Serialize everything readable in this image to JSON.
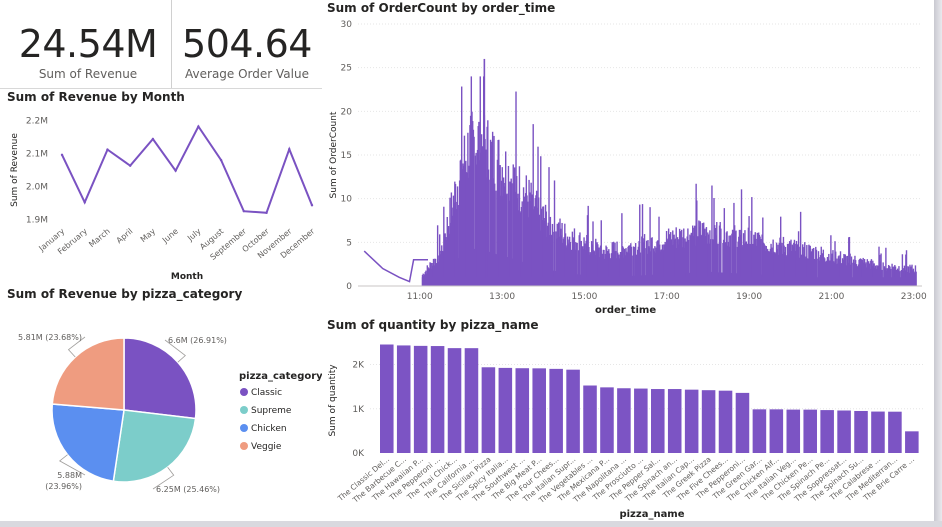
{
  "cards": [
    {
      "value": "24.54M",
      "label": "Sum of Revenue"
    },
    {
      "value": "504.64",
      "label": "Average Order Value"
    }
  ],
  "colors": {
    "accent": "#7a52c2",
    "bar": "#7c54c4"
  },
  "chart_data": [
    {
      "type": "line",
      "title": "Sum of Revenue by Month",
      "xlabel": "Month",
      "ylabel": "Sum of Revenue",
      "categories": [
        "January",
        "February",
        "March",
        "April",
        "May",
        "June",
        "July",
        "August",
        "September",
        "October",
        "November",
        "December"
      ],
      "values": [
        2.096,
        1.952,
        2.112,
        2.063,
        2.144,
        2.048,
        2.182,
        2.08,
        1.925,
        1.92,
        2.113,
        1.943
      ],
      "ylim": [
        1.88,
        2.22
      ],
      "yticks": [
        "1.9M",
        "2.0M",
        "2.1M",
        "2.2M"
      ],
      "ytick_values": [
        1.9,
        2.0,
        2.1,
        2.2
      ],
      "color": "#7a52c2"
    },
    {
      "type": "bar",
      "title": "Sum of OrderCount by order_time",
      "xlabel": "order_time",
      "ylabel": "Sum of OrderCount",
      "x_range": [
        9.5,
        23.2
      ],
      "ylim": [
        0,
        30
      ],
      "yticks": [
        "0",
        "5",
        "10",
        "15",
        "20",
        "25",
        "30"
      ],
      "ytick_values": [
        0,
        5,
        10,
        15,
        20,
        25,
        30
      ],
      "xticks": [
        "11:00",
        "13:00",
        "15:00",
        "17:00",
        "19:00",
        "21:00",
        "23:00"
      ],
      "xtick_values": [
        11,
        13,
        15,
        17,
        19,
        21,
        23
      ],
      "early_line": {
        "x": [
          9.65,
          10.1,
          10.5,
          10.75,
          10.85,
          11.1,
          11.2
        ],
        "y": [
          4,
          2,
          1,
          0.5,
          3,
          3,
          3
        ]
      },
      "profile": [
        {
          "x": 11.0,
          "y": 1
        },
        {
          "x": 11.5,
          "y": 4
        },
        {
          "x": 11.75,
          "y": 9
        },
        {
          "x": 12.0,
          "y": 14
        },
        {
          "x": 12.25,
          "y": 17
        },
        {
          "x": 12.5,
          "y": 17
        },
        {
          "x": 12.75,
          "y": 15
        },
        {
          "x": 13.0,
          "y": 14
        },
        {
          "x": 13.5,
          "y": 11
        },
        {
          "x": 14.0,
          "y": 8
        },
        {
          "x": 14.5,
          "y": 6
        },
        {
          "x": 15.0,
          "y": 5
        },
        {
          "x": 15.5,
          "y": 4
        },
        {
          "x": 16.0,
          "y": 4.5
        },
        {
          "x": 17.0,
          "y": 5.5
        },
        {
          "x": 17.5,
          "y": 6
        },
        {
          "x": 18.0,
          "y": 6.5
        },
        {
          "x": 18.5,
          "y": 6
        },
        {
          "x": 19.0,
          "y": 5.5
        },
        {
          "x": 20.0,
          "y": 4.5
        },
        {
          "x": 21.0,
          "y": 3.5
        },
        {
          "x": 22.0,
          "y": 2.5
        },
        {
          "x": 23.0,
          "y": 2
        }
      ],
      "peak_x": 12.55,
      "peak_y": 26,
      "color": "#7a52c2"
    },
    {
      "type": "pie",
      "title": "Sum of Revenue by pizza_category",
      "legend_title": "pizza_category",
      "slices": [
        {
          "name": "Classic",
          "value": 6.6,
          "label": "6.6M (26.91%)",
          "color": "#7a52c2"
        },
        {
          "name": "Supreme",
          "value": 6.25,
          "label": "6.25M (25.46%)",
          "color": "#7ccdca"
        },
        {
          "name": "Chicken",
          "value": 5.88,
          "label_line1": "5.88M",
          "label_line2": "(23.96%)",
          "color": "#5b8ff0"
        },
        {
          "name": "Veggie",
          "value": 5.81,
          "label": "5.81M (23.68%)",
          "color": "#ef9c80"
        }
      ]
    },
    {
      "type": "bar",
      "title": "Sum of quantity by pizza_name",
      "xlabel": "pizza_name",
      "ylabel": "Sum of quantity",
      "ylim": [
        0,
        2600
      ],
      "yticks": [
        "0K",
        "1K",
        "2K"
      ],
      "ytick_values": [
        0,
        1000,
        2000
      ],
      "categories": [
        "The Classic Del...",
        "The Barbecue C...",
        "The Hawaiian P...",
        "The Pepperoni ...",
        "The Thai Chick...",
        "The California ...",
        "The Sicilian Pizza",
        "The Spicy Italia...",
        "The Southwest ...",
        "The Big Meat P...",
        "The Four Chees...",
        "The Italian Supr...",
        "The Vegetables ...",
        "The Mexicana P...",
        "The Napolitana ...",
        "The Prosciutto ...",
        "The Pepper Sal...",
        "The Spinach an...",
        "The Italian Cap...",
        "The Greek Pizza",
        "The Five Chees...",
        "The Pepperoni...",
        "The Green Gar...",
        "The Chicken Alf...",
        "The Italian Veg...",
        "The Chicken Pe...",
        "The Spinach Pe...",
        "The Soppressat...",
        "The Spinach Su...",
        "The Calabrese ...",
        "The Mediterran...",
        "The Brie Carre ..."
      ],
      "values": [
        2453,
        2432,
        2422,
        2418,
        2371,
        2370,
        1938,
        1924,
        1917,
        1914,
        1902,
        1884,
        1526,
        1484,
        1464,
        1457,
        1446,
        1446,
        1432,
        1420,
        1409,
        1359,
        987,
        987,
        981,
        980,
        970,
        961,
        950,
        937,
        934,
        490
      ],
      "color": "#7c54c4"
    }
  ]
}
